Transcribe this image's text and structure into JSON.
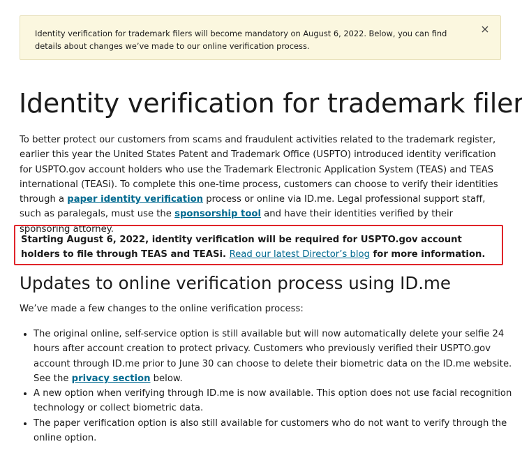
{
  "alert": {
    "text": "Identity verification for trademark filers will become mandatory on August 6, 2022. Below, you can find details about changes we’ve made to our online verification process.",
    "close_icon": "×"
  },
  "title": "Identity verification for trademark filers",
  "intro": {
    "part1": "To better protect our customers from scams and fraudulent activities related to the trademark register, earlier this year the United States Patent and Trademark Office (USPTO) introduced identity verification for USPTO.gov account holders who use the Trademark Electronic Application System (TEAS) and TEAS international (TEASi). To complete this one-time process, customers can choose to verify their identities through a ",
    "link1": "paper identity verification",
    "part2": " process or online via ID.me. Legal professional support staff, such as paralegals, must use the ",
    "link2": "sponsorship tool",
    "part3": " and have their identities verified by their sponsoring attorney."
  },
  "notice": {
    "bold_text": "Starting August 6, 2022, identity verification will be required for USPTO.gov account holders to file through TEAS and TEASi.",
    "link": "Read our latest Director’s blog",
    "suffix": " for more information.",
    "border_color": "#e0242a"
  },
  "section": {
    "title": "Updates to online verification process using ID.me",
    "intro": "We’ve made a few changes to the online verification process:",
    "items": [
      {
        "text": "The original online, self-service option is still available but will now automatically delete your selfie 24 hours after account creation to protect privacy. Customers who previously verified their USPTO.gov account through ID.me prior to June 30 can choose to delete their biometric data on the ID.me website. See the ",
        "link": "privacy section",
        "suffix": " below."
      },
      {
        "text": "A new option when verifying through ID.me is now available. This option does not use facial recognition technology or collect biometric data."
      },
      {
        "text": "The paper verification option is also still available for customers who do not want to verify through the online option."
      }
    ]
  },
  "colors": {
    "link": "#00698f",
    "alert_background": "#fbf7df",
    "text": "#1b1b1b"
  }
}
